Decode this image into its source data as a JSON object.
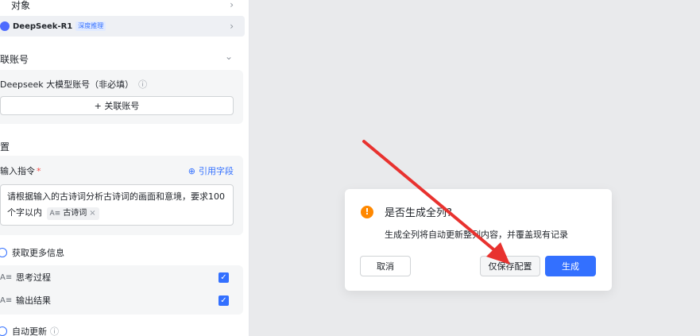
{
  "panel": {
    "object_label": "对象",
    "model": {
      "name": "DeepSeek-R1",
      "badge": "深度推理"
    },
    "linked_account": {
      "section_title": "联账号",
      "field_label": "Deepseek 大模型账号（非必填）",
      "button_label": "+ 关联账号"
    },
    "settings": {
      "section_title": "置",
      "instruction_label": "输入指令",
      "required_mark": "*",
      "ref_field_label": "引用字段",
      "prompt_text": "请根据输入的古诗词分析古诗词的画面和意境，要求100个字以内",
      "chip_label": "古诗词",
      "more_info_label": "获取更多信息",
      "options": [
        {
          "label": "思考过程",
          "checked": true
        },
        {
          "label": "输出结果",
          "checked": true
        }
      ],
      "auto_update_label": "自动更新"
    }
  },
  "dialog": {
    "title": "是否生成全列?",
    "body": "生成全列将自动更新整列内容，并覆盖现有记录",
    "cancel_label": "取消",
    "save_only_label": "仅保存配置",
    "generate_label": "生成"
  },
  "colors": {
    "accent": "#3370ff",
    "warning": "#ff8800",
    "annotation_arrow": "#e8322f"
  }
}
